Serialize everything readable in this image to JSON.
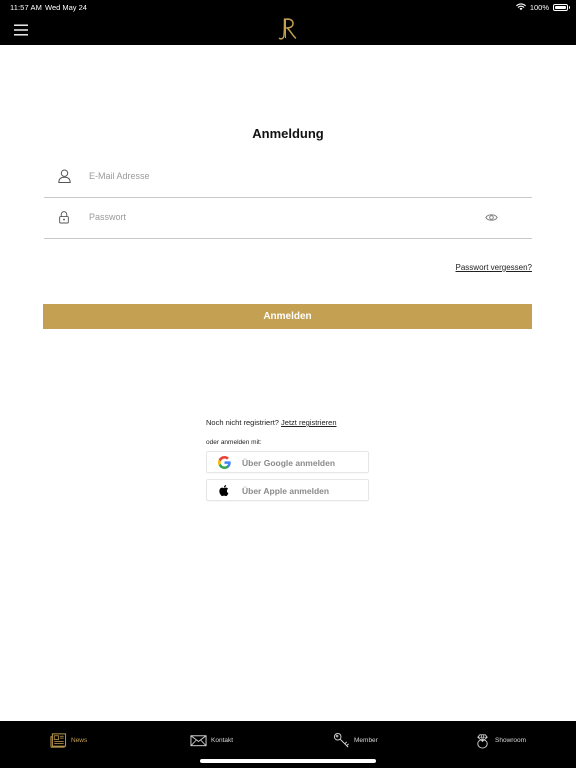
{
  "status_bar": {
    "time": "11:57 AM",
    "date": "Wed May 24",
    "battery": "100%",
    "battery_level": 1.0
  },
  "header": {
    "menu_icon": "hamburger-menu-icon",
    "logo_icon": "jr-monogram-logo",
    "logo_color": "#c4a052"
  },
  "login": {
    "title": "Anmeldung",
    "email": {
      "placeholder": "E-Mail Adresse",
      "value": "",
      "icon": "user-icon"
    },
    "password": {
      "placeholder": "Passwort",
      "value": "",
      "icon": "lock-icon",
      "toggle_icon": "eye-icon"
    },
    "forgot_link": "Passwort vergessen?",
    "submit_label": "Anmelden",
    "accent_color": "#c4a052"
  },
  "register": {
    "prompt": "Noch nicht registriert?",
    "link": "Jetzt registrieren",
    "alt_label": "oder anmelden mit:",
    "google_label": "Über Google anmelden",
    "apple_label": "Über Apple anmelden"
  },
  "tabbar": {
    "items": [
      {
        "label": "News",
        "icon": "newspaper-icon",
        "active": true
      },
      {
        "label": "Kontakt",
        "icon": "envelope-icon",
        "active": false
      },
      {
        "label": "Member",
        "icon": "key-icon",
        "active": false
      },
      {
        "label": "Showroom",
        "icon": "diamond-ring-icon",
        "active": false
      }
    ]
  }
}
